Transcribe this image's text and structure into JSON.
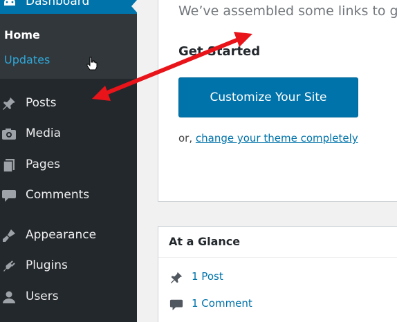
{
  "sidebar": {
    "dashboard_label": "Dashboard",
    "submenu": {
      "home": "Home",
      "updates": "Updates"
    },
    "items": [
      {
        "label": "Posts",
        "icon": "pushpin-icon"
      },
      {
        "label": "Media",
        "icon": "media-icon"
      },
      {
        "label": "Pages",
        "icon": "pages-icon"
      },
      {
        "label": "Comments",
        "icon": "comment-icon"
      },
      {
        "label": "Appearance",
        "icon": "paintbrush-icon"
      },
      {
        "label": "Plugins",
        "icon": "plug-icon"
      },
      {
        "label": "Users",
        "icon": "user-icon"
      }
    ]
  },
  "welcome": {
    "intro_text": "We’ve assembled some links to ge",
    "get_started_heading": "Get Started",
    "customize_button": "Customize Your Site",
    "or_prefix": "or, ",
    "change_theme_link": "change your theme completely"
  },
  "glance": {
    "title": "At a Glance",
    "posts": "1 Post",
    "comments": "1 Comment"
  },
  "colors": {
    "sidebar_bg": "#23282d",
    "submenu_bg": "#32373c",
    "accent": "#0073aa",
    "annotation_arrow": "#e8141a"
  }
}
